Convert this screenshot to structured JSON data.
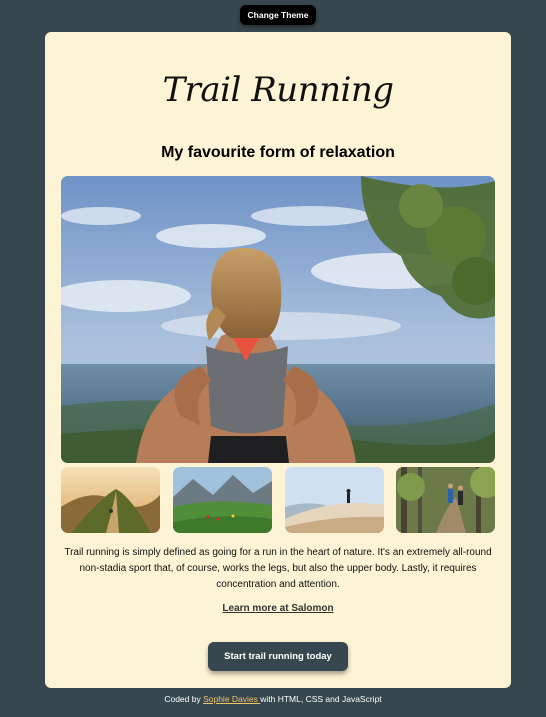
{
  "theme_button": {
    "label": "Change Theme"
  },
  "card": {
    "title": "Trail Running",
    "subtitle": "My favourite form of relaxation",
    "description": "Trail running is simply defined as going for a run in the heart of nature. It's an extremely all-round non-stadia sport that, of course, works the legs, but also the upper body. Lastly, it requires concentration and attention.",
    "learn_more": "Learn more at Salomon",
    "cta_label": "Start trail running today"
  },
  "footer": {
    "prefix": "Coded by ",
    "author": "Sophie Davies ",
    "suffix": "with HTML, CSS and JavaScript"
  },
  "colors": {
    "page_background": "#37474f",
    "card_background": "#fdf3d5",
    "theme_button": "#000000",
    "cta_button": "#37474f",
    "footer_link": "#f1c36a"
  }
}
